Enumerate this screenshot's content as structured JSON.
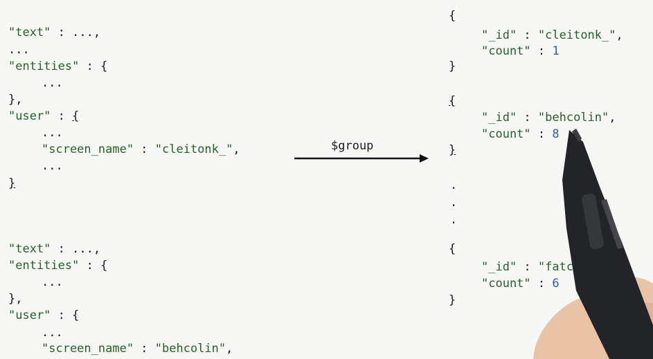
{
  "left_doc1": {
    "l1": {
      "key": "\"text\"",
      "rest": " : ...,"
    },
    "l2": "...",
    "l3": {
      "key": "\"entities\"",
      "rest": " : {"
    },
    "l4": "...",
    "l5": "},",
    "l6": {
      "key": "\"user\"",
      "rest": " : ",
      "brace": "{"
    },
    "l7": "...",
    "l8": {
      "key": "\"screen_name\"",
      "sep": " : ",
      "val": "\"cleitonk_\"",
      "end": ","
    },
    "l9": "...",
    "l10": "}"
  },
  "left_doc2": {
    "l1": {
      "key": "\"text\"",
      "rest": " : ...,"
    },
    "l2": {
      "key": "\"entities\"",
      "rest": " : {"
    },
    "l3": "...",
    "l4": "},",
    "l5": {
      "key": "\"user\"",
      "rest": " : {"
    },
    "l6": "...",
    "l7": {
      "key": "\"screen_name\"",
      "sep": " : ",
      "val": "\"behcolin\"",
      "end": ","
    }
  },
  "arrow": {
    "label": "$group"
  },
  "results": [
    {
      "open": "{",
      "id_key": "\"_id\"",
      "id_val": "\"cleitonk_\"",
      "count_key": "\"count\"",
      "count_val": "1",
      "close": "}"
    },
    {
      "open": "{",
      "id_key": "\"_id\"",
      "id_val": "\"behcolin\"",
      "count_key": "\"count\"",
      "count_val": "8",
      "close": "}"
    },
    {
      "open": "{",
      "id_key": "\"_id\"",
      "id_val": "\"fatcouncilor",
      "count_key": "\"count\"",
      "count_val": "6",
      "close": "}"
    }
  ],
  "ellipsis": [
    ".",
    ".",
    "."
  ],
  "colors": {
    "string": "#27612a",
    "number": "#2a5bb3",
    "text": "#1c1c1c",
    "background": "#f7f7f5"
  }
}
